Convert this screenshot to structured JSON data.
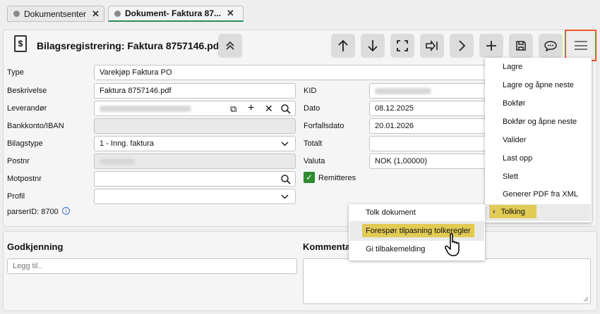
{
  "tabs": [
    {
      "label": "Dokumentsenter"
    },
    {
      "label": "Dokument- Faktura 87..."
    }
  ],
  "header": {
    "title": "Bilagsregistrering: Faktura 8757146.pdf",
    "icon": "document-dollar-icon"
  },
  "form": {
    "type_label": "Type",
    "type_value": "Varekjøp Faktura PO",
    "beskrivelse_label": "Beskrivelse",
    "beskrivelse_value": "Faktura 8757146.pdf",
    "leverandor_label": "Leverandør",
    "bankkonto_label": "Bankkonto/IBAN",
    "bilagstype_label": "Bilagstype",
    "bilagstype_value": "1 - Inng. faktura",
    "postnr_label": "Postnr",
    "motpostnr_label": "Motpostnr",
    "profil_label": "Profil",
    "parser_label": "parserID: 8700",
    "kid_label": "KID",
    "dato_label": "Dato",
    "dato_value": "08.12.2025",
    "forfallsdato_label": "Forfallsdato",
    "forfallsdato_value": "20.01.2026",
    "totalt_label": "Totalt",
    "valuta_label": "Valuta",
    "valuta_value": "NOK (1,00000)",
    "remitteres_label": "Remitteres"
  },
  "menu": {
    "items": [
      "Lagre",
      "Lagre og åpne neste",
      "Bokfør",
      "Bokfør og åpne neste",
      "Valider",
      "Last opp",
      "Slett",
      "Generer PDF fra XML"
    ],
    "active": "Tolking"
  },
  "submenu": {
    "items": [
      "Tolk dokument",
      "Forespør tilpasning tolkeregler",
      "Gi tilbakemelding"
    ]
  },
  "bottom": {
    "godkjenning_title": "Godkjenning",
    "legg_til_placeholder": "Legg til..",
    "kommentar_title": "Kommenta"
  },
  "colors": {
    "highlight": "#e2cb55",
    "menu_outline": "#ee5a2a",
    "check_green": "#2e8b2e",
    "active_tab_underline": "#2e8b57"
  }
}
